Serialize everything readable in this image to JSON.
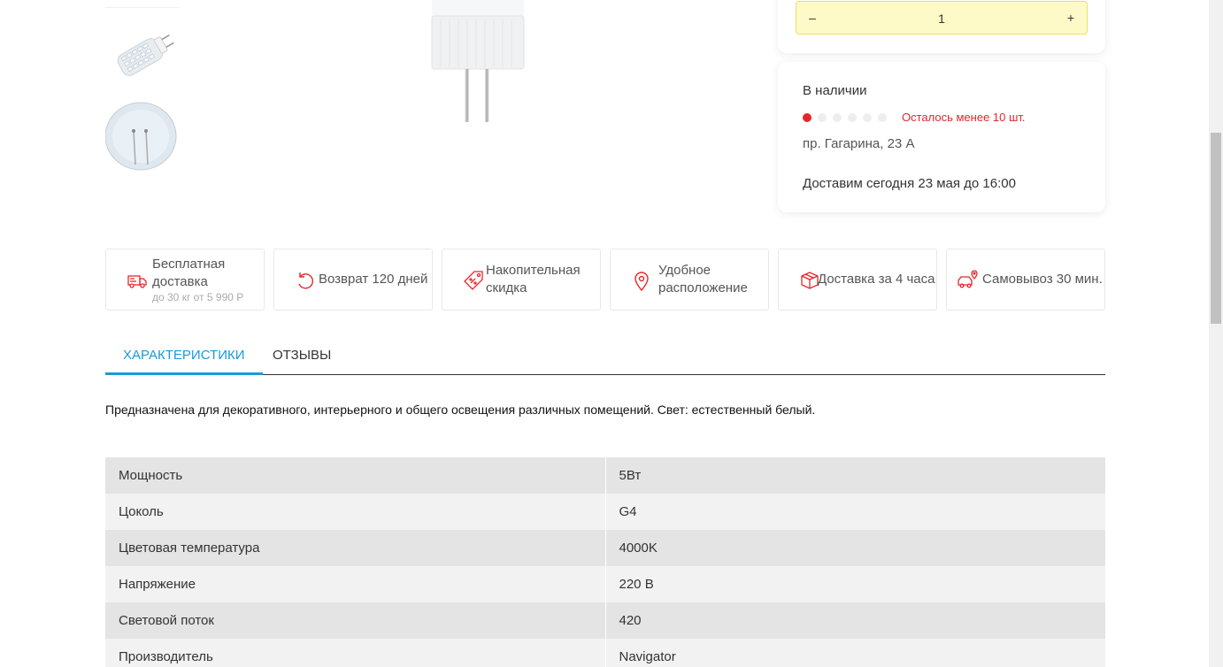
{
  "quantity": {
    "minus_label": "–",
    "value": "1",
    "plus_label": "+"
  },
  "stock": {
    "title": "В наличии",
    "level_dots_total": 6,
    "level_dots_filled": 1,
    "warning": "Осталось менее 10 шт.",
    "address": "пр. Гагарина, 23 А",
    "delivery": "Доставим сегодня 23 мая до 16:00"
  },
  "features": [
    {
      "icon": "delivery-truck-icon",
      "title": "Бесплатная доставка",
      "sub": "до 30 кг от 5 990 Р"
    },
    {
      "icon": "return-arrow-icon",
      "title": "Возврат 120 дней"
    },
    {
      "icon": "discount-tag-icon",
      "title": "Накопительная скидка"
    },
    {
      "icon": "location-pin-icon",
      "title": "Удобное расположение"
    },
    {
      "icon": "box-icon",
      "title": "Доставка за 4 часа"
    },
    {
      "icon": "car-pickup-icon",
      "title": "Самовывоз 30 мин."
    }
  ],
  "tabs": [
    {
      "label": "Характеристики",
      "active": true
    },
    {
      "label": "Отзывы",
      "active": false
    }
  ],
  "description": "Предназначена для декоративного, интерьерного и общего освещения различных помещений. Свет: естественный белый.",
  "specs": [
    {
      "key": "Мощность",
      "value": "5Вт"
    },
    {
      "key": "Цоколь",
      "value": "G4"
    },
    {
      "key": "Цветовая температура",
      "value": "4000K"
    },
    {
      "key": "Напряжение",
      "value": "220 В"
    },
    {
      "key": "Световой поток",
      "value": "420"
    },
    {
      "key": "Производитель",
      "value": "Navigator"
    }
  ],
  "colors": {
    "accent": "#1a9ad6",
    "warning": "#e8262a",
    "qty_bg": "#fdfac7"
  }
}
